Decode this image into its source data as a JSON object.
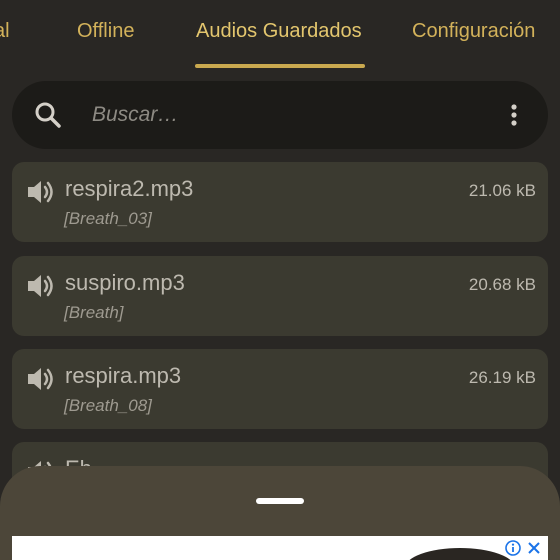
{
  "tabs": [
    {
      "label": "al"
    },
    {
      "label": "Offline"
    },
    {
      "label": "Audios Guardados",
      "active": true
    },
    {
      "label": "Configuración"
    }
  ],
  "search": {
    "placeholder": "Buscar…",
    "value": ""
  },
  "audios": [
    {
      "name": "respira2.mp3",
      "tag": "[Breath_03]",
      "size": "21.06 kB"
    },
    {
      "name": "suspiro.mp3",
      "tag": "[Breath]",
      "size": "20.68 kB"
    },
    {
      "name": "respira.mp3",
      "tag": "[Breath_08]",
      "size": "26.19 kB"
    },
    {
      "name": "Eh",
      "tag": "",
      "size": ""
    }
  ],
  "icons": {
    "search": "search-icon",
    "more": "more-vertical-icon",
    "speaker": "speaker-icon",
    "ad_info": "info-icon",
    "ad_close": "close-icon"
  },
  "colors": {
    "background": "#292724",
    "accent": "#d3b25a",
    "card": "#3b3a30",
    "search_bar": "#1c1b18",
    "sheet": "#4c4639"
  }
}
